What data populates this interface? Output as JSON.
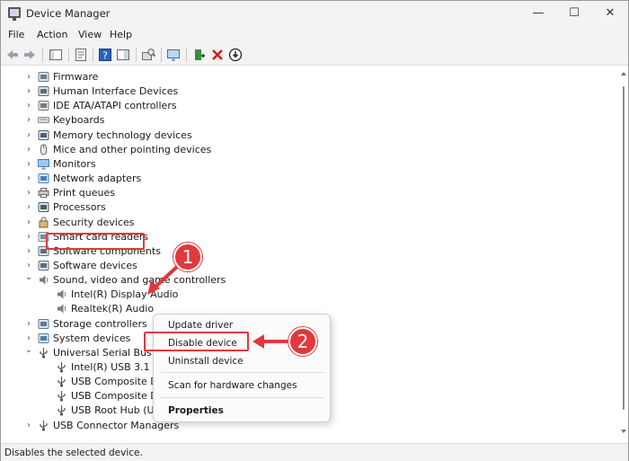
{
  "window": {
    "title": "Device Manager",
    "minimize": "—",
    "maximize": "☐",
    "close": "✕"
  },
  "menu": [
    "File",
    "Action",
    "View",
    "Help"
  ],
  "tree": [
    {
      "label": "Firmware",
      "expanded": false,
      "icon": "firmware-icon"
    },
    {
      "label": "Human Interface Devices",
      "expanded": false,
      "icon": "hid-icon"
    },
    {
      "label": "IDE ATA/ATAPI controllers",
      "expanded": false,
      "icon": "ide-icon"
    },
    {
      "label": "Keyboards",
      "expanded": false,
      "icon": "keyboard-icon"
    },
    {
      "label": "Memory technology devices",
      "expanded": false,
      "icon": "memory-icon"
    },
    {
      "label": "Mice and other pointing devices",
      "expanded": false,
      "icon": "mouse-icon"
    },
    {
      "label": "Monitors",
      "expanded": false,
      "icon": "monitor-icon"
    },
    {
      "label": "Network adapters",
      "expanded": false,
      "icon": "network-icon"
    },
    {
      "label": "Print queues",
      "expanded": false,
      "icon": "printer-icon"
    },
    {
      "label": "Processors",
      "expanded": false,
      "icon": "processor-icon"
    },
    {
      "label": "Security devices",
      "expanded": false,
      "icon": "security-icon"
    },
    {
      "label": "Smart card readers",
      "expanded": false,
      "icon": "smartcard-icon"
    },
    {
      "label": "Software components",
      "expanded": false,
      "icon": "software-component-icon"
    },
    {
      "label": "Software devices",
      "expanded": false,
      "icon": "software-device-icon"
    },
    {
      "label": "Sound, video and game controllers",
      "expanded": true,
      "icon": "speaker-icon"
    },
    {
      "label": "Intel(R) Display Audio",
      "child": true,
      "icon": "speaker-icon"
    },
    {
      "label": "Realtek(R) Audio",
      "child": true,
      "icon": "speaker-icon",
      "selected": true
    },
    {
      "label": "Storage controllers",
      "expanded": false,
      "icon": "storage-icon"
    },
    {
      "label": "System devices",
      "expanded": false,
      "icon": "system-icon"
    },
    {
      "label": "Universal Serial Bus controllers",
      "expanded": true,
      "icon": "usb-icon"
    },
    {
      "label": "Intel(R) USB 3.1 eXtensible Host Controller",
      "child": true,
      "icon": "usb-icon"
    },
    {
      "label": "USB Composite Device",
      "child": true,
      "icon": "usb-icon"
    },
    {
      "label": "USB Composite Device",
      "child": true,
      "icon": "usb-icon"
    },
    {
      "label": "USB Root Hub (USB 3.0)",
      "child": true,
      "icon": "usb-icon"
    },
    {
      "label": "USB Connector Managers",
      "expanded": false,
      "icon": "usb-icon"
    }
  ],
  "context_menu": {
    "update": "Update driver",
    "disable": "Disable device",
    "uninstall": "Uninstall device",
    "scan": "Scan for hardware changes",
    "properties": "Properties"
  },
  "callouts": {
    "one": "1",
    "two": "2"
  },
  "status": "Disables the selected device.",
  "colors": {
    "accent": "#e0393e",
    "chrome": "#f3f3f3"
  }
}
